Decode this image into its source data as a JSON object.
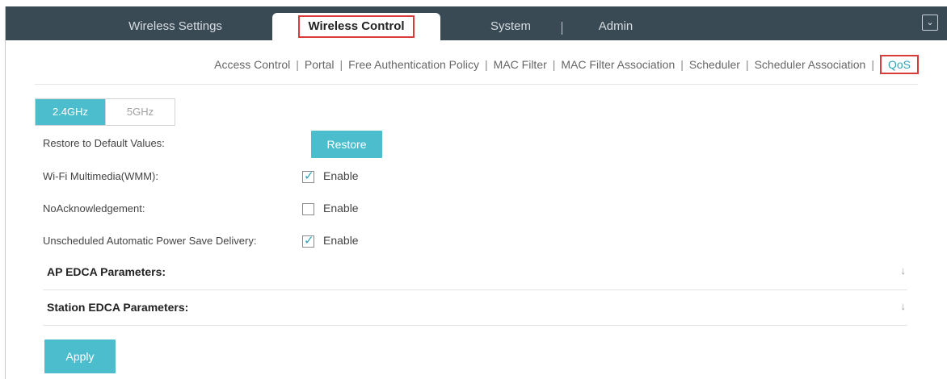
{
  "top_nav": {
    "tabs": [
      {
        "label": "Wireless Settings"
      },
      {
        "label": "Wireless Control"
      },
      {
        "label": "System"
      },
      {
        "label": "Admin"
      }
    ]
  },
  "sub_nav": {
    "items": [
      {
        "label": "Access Control"
      },
      {
        "label": "Portal"
      },
      {
        "label": "Free Authentication Policy"
      },
      {
        "label": "MAC Filter"
      },
      {
        "label": "MAC Filter Association"
      },
      {
        "label": "Scheduler"
      },
      {
        "label": "Scheduler Association"
      },
      {
        "label": "QoS"
      }
    ],
    "separator": "|"
  },
  "band_tabs": [
    {
      "label": "2.4GHz"
    },
    {
      "label": "5GHz"
    }
  ],
  "restore": {
    "label": "Restore to Default Values:",
    "button": "Restore"
  },
  "options": [
    {
      "label": "Wi-Fi Multimedia(WMM):",
      "checkbox_label": "Enable",
      "checked": true
    },
    {
      "label": "NoAcknowledgement:",
      "checkbox_label": "Enable",
      "checked": false
    },
    {
      "label": "Unscheduled Automatic Power Save Delivery:",
      "checkbox_label": "Enable",
      "checked": true
    }
  ],
  "sections": [
    {
      "title": "AP EDCA Parameters:"
    },
    {
      "title": "Station EDCA Parameters:"
    }
  ],
  "apply_button": "Apply",
  "icons": {
    "menu": "chevron-down-icon",
    "expand": "double-chevron-down-icon",
    "check": "checkmark-icon"
  },
  "colors": {
    "topbar": "#3a4a55",
    "accent": "#4bbdcc",
    "highlight_box": "#d93a3a"
  }
}
